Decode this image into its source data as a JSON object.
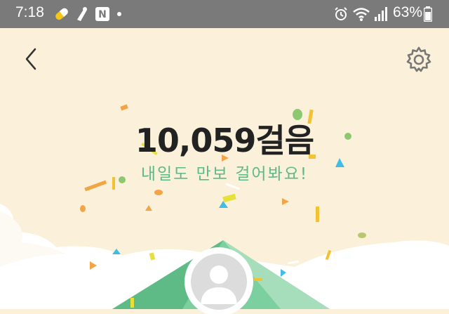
{
  "status_bar": {
    "time": "7:18",
    "notification_icons": [
      "pill-icon",
      "pedometer-app-icon",
      "naver-icon",
      "dot-icon"
    ],
    "system_icons": [
      "alarm-icon",
      "wifi-icon",
      "signal-icon",
      "battery-icon"
    ],
    "battery": "63%"
  },
  "header": {
    "back_icon": "chevron-left-icon",
    "settings_icon": "gear-icon"
  },
  "result": {
    "steps": "10,059걸음",
    "message": "내일도 만보 걸어봐요!"
  },
  "colors": {
    "background": "#fbf1da",
    "status_bar": "#7a7a7a",
    "message_green": "#5fb888",
    "mountain_green": "#74c79a"
  }
}
